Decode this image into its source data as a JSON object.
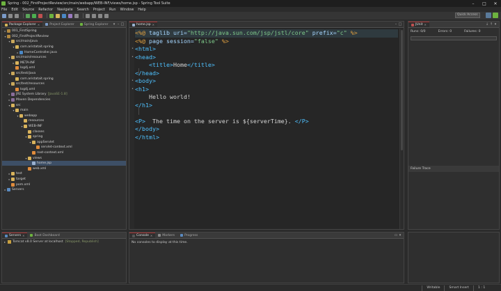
{
  "window": {
    "title": "Spring - 002_FirstProjectReview/src/main/webapp/WEB-INF/views/home.jsp - Spring Tool Suite"
  },
  "menu": [
    "File",
    "Edit",
    "Source",
    "Refactor",
    "Navigate",
    "Search",
    "Project",
    "Run",
    "Window",
    "Help"
  ],
  "toolbar": {
    "quick_access": "Quick Access"
  },
  "left_panel": {
    "tabs": [
      "Package Explorer",
      "Project Explorer",
      "Spring Explorer"
    ],
    "tree": [
      {
        "label": "001_FirstSpring",
        "arrow": "▸",
        "icon": "proj",
        "indent": 0
      },
      {
        "label": "002_FirstProjectReview",
        "arrow": "▾",
        "icon": "proj",
        "indent": 0
      },
      {
        "label": "src/main/java",
        "arrow": "▾",
        "icon": "src",
        "indent": 1
      },
      {
        "label": "com.aristatait.spring",
        "arrow": "▾",
        "icon": "pkg",
        "indent": 2
      },
      {
        "label": "HomeController.java",
        "arrow": "▸",
        "icon": "java",
        "indent": 3
      },
      {
        "label": "src/main/resources",
        "arrow": "▾",
        "icon": "src",
        "indent": 1
      },
      {
        "label": "META-INF",
        "arrow": "▸",
        "icon": "folder",
        "indent": 2
      },
      {
        "label": "log4j.xml",
        "arrow": "",
        "icon": "xml",
        "indent": 2
      },
      {
        "label": "src/test/java",
        "arrow": "▾",
        "icon": "src",
        "indent": 1
      },
      {
        "label": "com.aristatait.spring",
        "arrow": "",
        "icon": "pkg",
        "indent": 2
      },
      {
        "label": "src/test/resources",
        "arrow": "▾",
        "icon": "src",
        "indent": 1
      },
      {
        "label": "log4j.xml",
        "arrow": "",
        "icon": "xml",
        "indent": 2
      },
      {
        "label": "JRE System Library",
        "dim": "[JavaSE-1.8]",
        "arrow": "▸",
        "icon": "jar",
        "indent": 1
      },
      {
        "label": "Maven Dependencies",
        "arrow": "▸",
        "icon": "jar",
        "indent": 1
      },
      {
        "label": "src",
        "arrow": "▾",
        "icon": "folder",
        "indent": 1
      },
      {
        "label": "main",
        "arrow": "▾",
        "icon": "folder",
        "indent": 2
      },
      {
        "label": "webapp",
        "arrow": "▾",
        "icon": "folder",
        "indent": 3
      },
      {
        "label": "resources",
        "arrow": "",
        "icon": "folder",
        "indent": 4
      },
      {
        "label": "WEB-INF",
        "arrow": "▾",
        "icon": "folder",
        "indent": 4
      },
      {
        "label": "classes",
        "arrow": "",
        "icon": "folder",
        "indent": 5
      },
      {
        "label": "spring",
        "arrow": "▾",
        "icon": "folder",
        "indent": 5
      },
      {
        "label": "appServlet",
        "arrow": "▾",
        "icon": "folder",
        "indent": 6
      },
      {
        "label": "servlet-context.xml",
        "arrow": "",
        "icon": "xml",
        "indent": 7
      },
      {
        "label": "root-context.xml",
        "arrow": "",
        "icon": "xml",
        "indent": 6
      },
      {
        "label": "views",
        "arrow": "▾",
        "icon": "folder",
        "indent": 5
      },
      {
        "label": "home.jsp",
        "arrow": "",
        "icon": "jsp",
        "indent": 6,
        "selected": true
      },
      {
        "label": "web.xml",
        "arrow": "",
        "icon": "xml",
        "indent": 5
      },
      {
        "label": "test",
        "arrow": "▸",
        "icon": "folder",
        "indent": 1
      },
      {
        "label": "target",
        "arrow": "▸",
        "icon": "folder",
        "indent": 1
      },
      {
        "label": "pom.xml",
        "arrow": "",
        "icon": "xml",
        "indent": 1
      },
      {
        "label": "Servers",
        "arrow": "▸",
        "icon": "srv",
        "indent": 0
      }
    ]
  },
  "editor": {
    "tab": "home.jsp",
    "lines": [
      {
        "segments": [
          [
            "dir",
            "<%@ "
          ],
          [
            "attr",
            "taglib uri="
          ],
          [
            "str",
            "\"http://java.sun.com/jsp/jstl/core\""
          ],
          [
            "attr",
            " prefix="
          ],
          [
            "str",
            "\"c\""
          ],
          [
            "dir",
            " %>"
          ]
        ],
        "current": true
      },
      {
        "segments": [
          [
            "dir",
            "<%@ "
          ],
          [
            "attr",
            "page session="
          ],
          [
            "str",
            "\"false\""
          ],
          [
            "dir",
            " %>"
          ]
        ]
      },
      {
        "segments": [
          [
            "tag",
            "<html>"
          ]
        ],
        "fold": "•"
      },
      {
        "segments": [
          [
            "tag",
            "<head>"
          ]
        ],
        "fold": "•"
      },
      {
        "segments": [
          [
            "text",
            "    "
          ],
          [
            "tag",
            "<title>"
          ],
          [
            "text",
            "Home"
          ],
          [
            "tag",
            "</title>"
          ]
        ]
      },
      {
        "segments": [
          [
            "tag",
            "</head>"
          ]
        ]
      },
      {
        "segments": [
          [
            "tag",
            "<body>"
          ]
        ],
        "fold": "•"
      },
      {
        "segments": [
          [
            "tag",
            "<h1>"
          ]
        ],
        "fold": "•"
      },
      {
        "segments": [
          [
            "text",
            "    Hello world!"
          ]
        ]
      },
      {
        "segments": [
          [
            "tag",
            "</h1>"
          ]
        ]
      },
      {
        "segments": [
          [
            "text",
            ""
          ]
        ]
      },
      {
        "segments": [
          [
            "tag",
            "<P>"
          ],
          [
            "text",
            "  The time on the server is ${serverTime}. "
          ],
          [
            "tag",
            "</P>"
          ]
        ]
      },
      {
        "segments": [
          [
            "tag",
            "</body>"
          ]
        ]
      },
      {
        "segments": [
          [
            "tag",
            "</html>"
          ]
        ]
      }
    ]
  },
  "junit": {
    "tab": "JUnit",
    "runs": "Runs: 0/0",
    "errors": "Errors: 0",
    "failures": "Failures: 0",
    "failure_trace": "Failure Trace"
  },
  "servers_panel": {
    "tabs": [
      "Servers",
      "Boot Dashboard"
    ],
    "server_name": "Tomcat v8.0 Server at localhost",
    "server_status": "[Stopped, Republish]"
  },
  "console_panel": {
    "tabs": [
      "Console",
      "Markers",
      "Progress"
    ],
    "message": "No consoles to display at this time."
  },
  "statusbar": {
    "mode": "Writable",
    "insert": "Smart Insert",
    "position": "1 : 1"
  },
  "colors": {
    "tag": "#4fc1ff",
    "string": "#7ec98a",
    "directive": "#e0a040",
    "selection": "#3d4f66"
  }
}
